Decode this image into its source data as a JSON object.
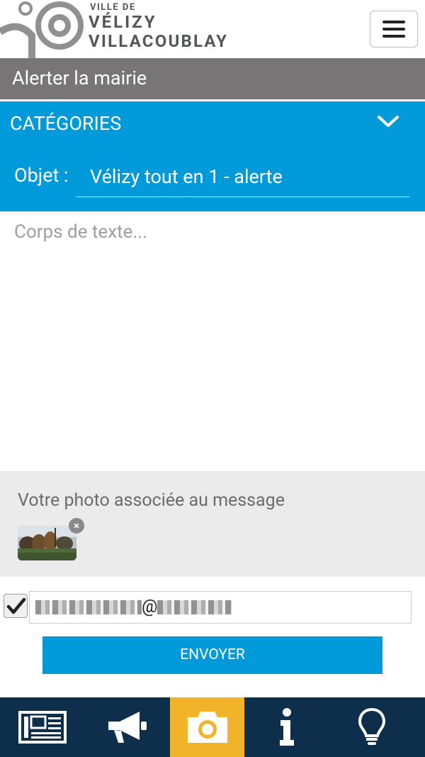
{
  "header": {
    "logo_small": "VILLE DE",
    "logo_line1": "VÉLIZY",
    "logo_line2": "VILLACOUBLAY",
    "menu_icon": "hamburger-icon"
  },
  "title_bar": {
    "title": "Alerter la mairie"
  },
  "categories": {
    "label": "CATÉGORIES",
    "icon": "chevron-down-icon"
  },
  "objet": {
    "label": "Objet :",
    "value": "Vélizy tout en 1 - alerte"
  },
  "body": {
    "placeholder": "Corps de texte..."
  },
  "photo": {
    "label": "Votre photo associée au message",
    "remove_icon": "close-circle-icon"
  },
  "email": {
    "checked": true,
    "at_sign": "@"
  },
  "send_button": {
    "label": "ENVOYER"
  },
  "bottom_nav": {
    "items": [
      {
        "icon": "newspaper-icon",
        "active": false
      },
      {
        "icon": "megaphone-icon",
        "active": false
      },
      {
        "icon": "camera-icon",
        "active": true
      },
      {
        "icon": "info-icon",
        "active": false
      },
      {
        "icon": "lightbulb-icon",
        "active": false
      }
    ],
    "active_color": "#f0b32a",
    "background": "#0e2f4c"
  },
  "colors": {
    "primary": "#0099d9",
    "title_bar": "#787577",
    "photo_section": "#ebebeb"
  }
}
